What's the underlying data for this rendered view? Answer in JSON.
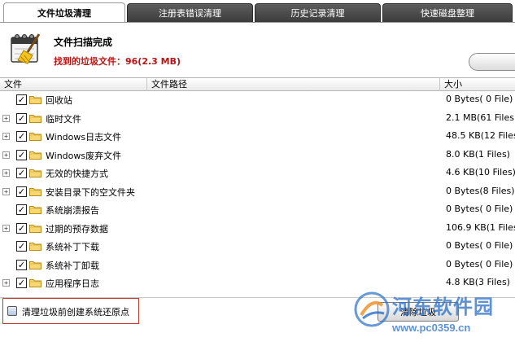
{
  "tabs": [
    {
      "label": "文件垃圾清理",
      "active": true
    },
    {
      "label": "注册表错误清理",
      "active": false
    },
    {
      "label": "历史记录清理",
      "active": false
    },
    {
      "label": "快速磁盘整理",
      "active": false
    }
  ],
  "header": {
    "title": "文件扫描完成",
    "subtitle": "找到的垃圾文件：96(2.3 MB)"
  },
  "table": {
    "columns": {
      "file": "文件",
      "path": "文件路径",
      "size": "大小"
    },
    "rows": [
      {
        "name": "回收站",
        "size": "0 Bytes( 0 File)",
        "expandable": false,
        "checked": true
      },
      {
        "name": "临时文件",
        "size": "2.1 MB(61 Files)",
        "expandable": true,
        "checked": true
      },
      {
        "name": "Windows日志文件",
        "size": "48.5 KB(12 Files)",
        "expandable": true,
        "checked": true
      },
      {
        "name": "Windows废弃文件",
        "size": "8.0 KB(1 Files)",
        "expandable": true,
        "checked": true
      },
      {
        "name": "无效的快捷方式",
        "size": "4.6 KB(10 Files)",
        "expandable": true,
        "checked": true
      },
      {
        "name": "安装目录下的空文件夹",
        "size": "0 Bytes(8 Files)",
        "expandable": true,
        "checked": true
      },
      {
        "name": "系统崩溃报告",
        "size": "0 Bytes( 0 File)",
        "expandable": false,
        "checked": true
      },
      {
        "name": "过期的预存数据",
        "size": "106.9 KB(1 Files)",
        "expandable": true,
        "checked": true
      },
      {
        "name": "系统补丁下载",
        "size": "0 Bytes( 0 File)",
        "expandable": false,
        "checked": true
      },
      {
        "name": "系统补丁卸载",
        "size": "0 Bytes( 0 File)",
        "expandable": false,
        "checked": true
      },
      {
        "name": "应用程序日志",
        "size": "4.8 KB(3 Files)",
        "expandable": true,
        "checked": true
      }
    ]
  },
  "footer": {
    "restore_label": "清理垃圾前创建系统还原点",
    "restore_checked": false,
    "clean_button": "清除垃圾"
  },
  "watermark": {
    "text": "河东软件园",
    "url": "www.pc0359.cn"
  },
  "colors": {
    "subtitle_red": "#b81414",
    "tab_dark": "#4a4a4a",
    "watermark_blue": "#286ec8"
  }
}
